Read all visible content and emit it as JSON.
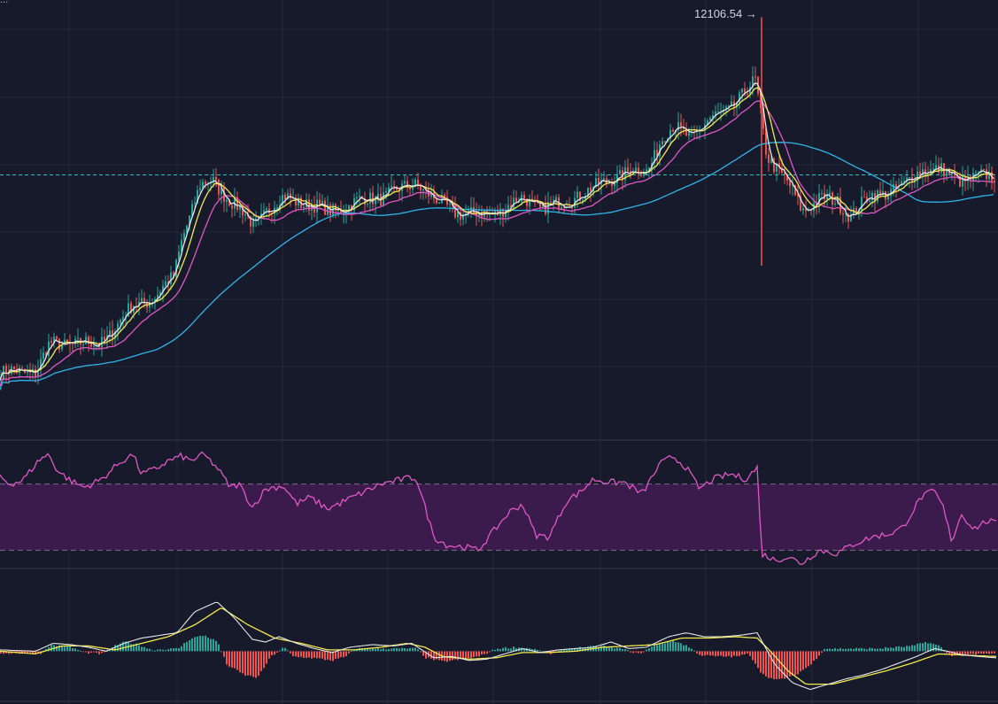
{
  "theme": {
    "background": "#161a2b",
    "grid": "#232839",
    "separator": "#363a45",
    "up": "#26a69a",
    "down": "#ef5350",
    "ma_fast": "#e6e6e6",
    "ma_mid": "#f5e94a",
    "ma_slow": "#e057c6",
    "ma_long": "#2fb4e9",
    "rsi_line": "#e057c6",
    "rsi_band": "#3b1a4c",
    "ref_line": "#26c6c6",
    "macd_line": "#e6e6e6",
    "signal_line": "#f5e94a"
  },
  "corner_label": "...",
  "chart_data": [
    {
      "type": "candlestick",
      "panel": "price",
      "annotation": "12106.54",
      "annotation_arrow": "→",
      "ylim": [
        10300,
        12180
      ],
      "reference_line": 11430,
      "anchors": [
        [
          0,
          10580
        ],
        [
          40,
          10590
        ],
        [
          55,
          10700
        ],
        [
          80,
          10710
        ],
        [
          110,
          10700
        ],
        [
          130,
          10780
        ],
        [
          150,
          10870
        ],
        [
          175,
          10910
        ],
        [
          195,
          10990
        ],
        [
          205,
          11170
        ],
        [
          225,
          11380
        ],
        [
          240,
          11400
        ],
        [
          255,
          11340
        ],
        [
          270,
          11280
        ],
        [
          285,
          11210
        ],
        [
          300,
          11280
        ],
        [
          320,
          11330
        ],
        [
          345,
          11310
        ],
        [
          370,
          11270
        ],
        [
          400,
          11310
        ],
        [
          430,
          11340
        ],
        [
          455,
          11370
        ],
        [
          470,
          11400
        ],
        [
          490,
          11320
        ],
        [
          510,
          11280
        ],
        [
          530,
          11260
        ],
        [
          550,
          11260
        ],
        [
          570,
          11290
        ],
        [
          590,
          11330
        ],
        [
          610,
          11290
        ],
        [
          630,
          11300
        ],
        [
          650,
          11340
        ],
        [
          670,
          11370
        ],
        [
          690,
          11420
        ],
        [
          710,
          11440
        ],
        [
          730,
          11450
        ],
        [
          745,
          11580
        ],
        [
          760,
          11630
        ],
        [
          780,
          11600
        ],
        [
          800,
          11660
        ],
        [
          820,
          11710
        ],
        [
          840,
          11780
        ],
        [
          852,
          11830
        ],
        [
          858,
          11690
        ],
        [
          865,
          11520
        ],
        [
          878,
          11450
        ],
        [
          890,
          11380
        ],
        [
          905,
          11280
        ],
        [
          925,
          11330
        ],
        [
          945,
          11310
        ],
        [
          960,
          11260
        ],
        [
          980,
          11330
        ],
        [
          1000,
          11360
        ],
        [
          1020,
          11380
        ],
        [
          1040,
          11460
        ],
        [
          1060,
          11450
        ],
        [
          1080,
          11410
        ],
        [
          1100,
          11420
        ],
        [
          1120,
          11420
        ]
      ],
      "spikes": [
        [
          860,
          11040,
          12106.54
        ]
      ]
    },
    {
      "type": "line",
      "panel": "rsi",
      "band": [
        30,
        70
      ],
      "ylim": [
        20,
        95
      ],
      "values": [
        [
          0,
          75
        ],
        [
          10,
          70
        ],
        [
          25,
          72
        ],
        [
          45,
          85
        ],
        [
          55,
          88
        ],
        [
          65,
          78
        ],
        [
          80,
          72
        ],
        [
          95,
          68
        ],
        [
          115,
          73
        ],
        [
          135,
          83
        ],
        [
          150,
          88
        ],
        [
          160,
          76
        ],
        [
          175,
          79
        ],
        [
          190,
          84
        ],
        [
          205,
          87
        ],
        [
          215,
          84
        ],
        [
          230,
          88
        ],
        [
          245,
          80
        ],
        [
          260,
          68
        ],
        [
          270,
          70
        ],
        [
          285,
          56
        ],
        [
          300,
          67
        ],
        [
          320,
          69
        ],
        [
          335,
          58
        ],
        [
          350,
          62
        ],
        [
          370,
          55
        ],
        [
          390,
          60
        ],
        [
          410,
          65
        ],
        [
          430,
          70
        ],
        [
          455,
          73
        ],
        [
          470,
          74
        ],
        [
          490,
          38
        ],
        [
          505,
          33
        ],
        [
          525,
          32
        ],
        [
          540,
          30
        ],
        [
          555,
          40
        ],
        [
          575,
          53
        ],
        [
          590,
          58
        ],
        [
          605,
          39
        ],
        [
          620,
          38
        ],
        [
          640,
          60
        ],
        [
          655,
          65
        ],
        [
          670,
          73
        ],
        [
          690,
          71
        ],
        [
          705,
          71
        ],
        [
          725,
          64
        ],
        [
          745,
          82
        ],
        [
          760,
          87
        ],
        [
          775,
          80
        ],
        [
          790,
          67
        ],
        [
          805,
          73
        ],
        [
          825,
          76
        ],
        [
          842,
          73
        ],
        [
          855,
          80
        ],
        [
          860,
          28
        ],
        [
          875,
          24
        ],
        [
          890,
          26
        ],
        [
          905,
          22
        ],
        [
          925,
          30
        ],
        [
          945,
          28
        ],
        [
          965,
          34
        ],
        [
          985,
          38
        ],
        [
          1005,
          40
        ],
        [
          1020,
          44
        ],
        [
          1040,
          62
        ],
        [
          1055,
          66
        ],
        [
          1065,
          56
        ],
        [
          1075,
          35
        ],
        [
          1085,
          52
        ],
        [
          1100,
          43
        ],
        [
          1115,
          48
        ],
        [
          1125,
          46
        ]
      ]
    },
    {
      "type": "macd",
      "panel": "macd",
      "ylim": [
        -80,
        120
      ],
      "macd": [
        [
          0,
          2
        ],
        [
          40,
          0
        ],
        [
          60,
          12
        ],
        [
          80,
          10
        ],
        [
          100,
          6
        ],
        [
          120,
          0
        ],
        [
          140,
          12
        ],
        [
          160,
          20
        ],
        [
          180,
          24
        ],
        [
          200,
          28
        ],
        [
          220,
          60
        ],
        [
          245,
          75
        ],
        [
          265,
          50
        ],
        [
          285,
          18
        ],
        [
          300,
          14
        ],
        [
          315,
          22
        ],
        [
          335,
          12
        ],
        [
          355,
          4
        ],
        [
          375,
          -2
        ],
        [
          395,
          6
        ],
        [
          420,
          10
        ],
        [
          445,
          8
        ],
        [
          465,
          12
        ],
        [
          490,
          -10
        ],
        [
          510,
          -8
        ],
        [
          530,
          -14
        ],
        [
          550,
          -12
        ],
        [
          570,
          -4
        ],
        [
          590,
          4
        ],
        [
          610,
          -2
        ],
        [
          630,
          2
        ],
        [
          650,
          4
        ],
        [
          670,
          6
        ],
        [
          690,
          14
        ],
        [
          710,
          4
        ],
        [
          730,
          6
        ],
        [
          755,
          22
        ],
        [
          775,
          28
        ],
        [
          795,
          22
        ],
        [
          815,
          22
        ],
        [
          835,
          24
        ],
        [
          855,
          28
        ],
        [
          875,
          -20
        ],
        [
          895,
          -48
        ],
        [
          915,
          -58
        ],
        [
          935,
          -50
        ],
        [
          955,
          -42
        ],
        [
          975,
          -36
        ],
        [
          995,
          -28
        ],
        [
          1015,
          -18
        ],
        [
          1035,
          -8
        ],
        [
          1055,
          4
        ],
        [
          1070,
          0
        ],
        [
          1085,
          -5
        ],
        [
          1105,
          -8
        ],
        [
          1125,
          -10
        ]
      ],
      "signal": [
        [
          0,
          0
        ],
        [
          40,
          -4
        ],
        [
          70,
          8
        ],
        [
          100,
          8
        ],
        [
          130,
          2
        ],
        [
          160,
          12
        ],
        [
          190,
          22
        ],
        [
          220,
          40
        ],
        [
          250,
          66
        ],
        [
          280,
          40
        ],
        [
          310,
          20
        ],
        [
          340,
          12
        ],
        [
          370,
          2
        ],
        [
          400,
          2
        ],
        [
          430,
          6
        ],
        [
          460,
          12
        ],
        [
          480,
          6
        ],
        [
          500,
          -8
        ],
        [
          530,
          -12
        ],
        [
          560,
          -10
        ],
        [
          590,
          -2
        ],
        [
          620,
          -2
        ],
        [
          650,
          0
        ],
        [
          680,
          6
        ],
        [
          710,
          8
        ],
        [
          740,
          10
        ],
        [
          770,
          20
        ],
        [
          800,
          20
        ],
        [
          830,
          22
        ],
        [
          855,
          20
        ],
        [
          870,
          0
        ],
        [
          890,
          -30
        ],
        [
          910,
          -50
        ],
        [
          940,
          -50
        ],
        [
          970,
          -40
        ],
        [
          1000,
          -30
        ],
        [
          1030,
          -18
        ],
        [
          1060,
          -4
        ],
        [
          1090,
          -6
        ],
        [
          1125,
          -8
        ]
      ],
      "histogram": [
        [
          0,
          -3
        ],
        [
          45,
          -3
        ],
        [
          55,
          9
        ],
        [
          75,
          8
        ],
        [
          95,
          -2
        ],
        [
          115,
          -4
        ],
        [
          125,
          6
        ],
        [
          140,
          14
        ],
        [
          155,
          10
        ],
        [
          170,
          2
        ],
        [
          200,
          4
        ],
        [
          215,
          20
        ],
        [
          230,
          24
        ],
        [
          245,
          14
        ],
        [
          255,
          -20
        ],
        [
          275,
          -36
        ],
        [
          290,
          -40
        ],
        [
          305,
          -8
        ],
        [
          320,
          6
        ],
        [
          330,
          -8
        ],
        [
          350,
          -10
        ],
        [
          375,
          -14
        ],
        [
          390,
          -8
        ],
        [
          400,
          4
        ],
        [
          420,
          4
        ],
        [
          445,
          4
        ],
        [
          470,
          4
        ],
        [
          480,
          -10
        ],
        [
          500,
          -16
        ],
        [
          520,
          -12
        ],
        [
          540,
          -8
        ],
        [
          560,
          4
        ],
        [
          580,
          6
        ],
        [
          600,
          4
        ],
        [
          620,
          -4
        ],
        [
          640,
          4
        ],
        [
          660,
          6
        ],
        [
          680,
          8
        ],
        [
          700,
          4
        ],
        [
          720,
          -4
        ],
        [
          740,
          10
        ],
        [
          760,
          16
        ],
        [
          775,
          8
        ],
        [
          790,
          -6
        ],
        [
          810,
          -8
        ],
        [
          830,
          -8
        ],
        [
          845,
          -4
        ],
        [
          860,
          -35
        ],
        [
          875,
          -44
        ],
        [
          895,
          -38
        ],
        [
          915,
          -20
        ],
        [
          930,
          4
        ],
        [
          950,
          4
        ],
        [
          970,
          4
        ],
        [
          990,
          4
        ],
        [
          1010,
          6
        ],
        [
          1030,
          8
        ],
        [
          1045,
          14
        ],
        [
          1060,
          8
        ],
        [
          1070,
          -6
        ],
        [
          1090,
          -6
        ],
        [
          1110,
          -4
        ],
        [
          1125,
          -4
        ]
      ]
    }
  ]
}
